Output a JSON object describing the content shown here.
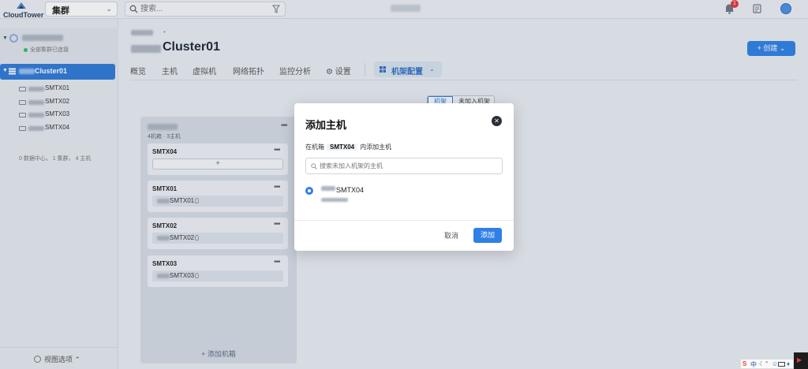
{
  "app": {
    "logo_text": "CloudTower"
  },
  "topbar": {
    "cluster_select": "集群",
    "search_placeholder": "搜索...",
    "notification_count": "1"
  },
  "sidebar": {
    "datacenter_status": "全部集群已连接",
    "cluster_name": "Cluster01",
    "hosts": [
      {
        "label": "SMTX01"
      },
      {
        "label": "SMTX02"
      },
      {
        "label": "SMTX03"
      },
      {
        "label": "SMTX04"
      }
    ],
    "stats": "0 数据中心， 1 集群， 4 主机",
    "view_options": "视图选项"
  },
  "main": {
    "breadcrumb_sep": "•",
    "title": "Cluster01",
    "create_button": "+ 创建 ⌄",
    "tabs": [
      {
        "label": "概览"
      },
      {
        "label": "主机"
      },
      {
        "label": "虚拟机"
      },
      {
        "label": "网络拓扑"
      },
      {
        "label": "监控分析"
      },
      {
        "label": "设置"
      }
    ],
    "active_tab": "机架配置",
    "toggle": {
      "rack": "机架",
      "unassigned": "未加入机架"
    },
    "rack": {
      "subtitle": "4机箱 · 3主机",
      "slots": [
        {
          "title": "SMTX04",
          "host": ""
        },
        {
          "title": "SMTX01",
          "host": "SMTX01"
        },
        {
          "title": "SMTX02",
          "host": "SMTX02"
        },
        {
          "title": "SMTX03",
          "host": "SMTX03"
        }
      ],
      "add_slot_symbol": "+",
      "add_rack": "+ 添加机箱"
    }
  },
  "modal": {
    "title": "添加主机",
    "desc_prefix": "在机箱",
    "desc_tag": "SMTX04",
    "desc_suffix": "内添加主机",
    "search_placeholder": "搜索未加入机架的主机",
    "option_label": "SMTX04",
    "cancel": "取消",
    "confirm": "添加"
  },
  "tray": {
    "ime_s": "S",
    "ime_zh": "中"
  },
  "colors": {
    "primary": "#2f80e6",
    "sidebar_selected": "#2f7ad6",
    "danger": "#e4363a"
  }
}
